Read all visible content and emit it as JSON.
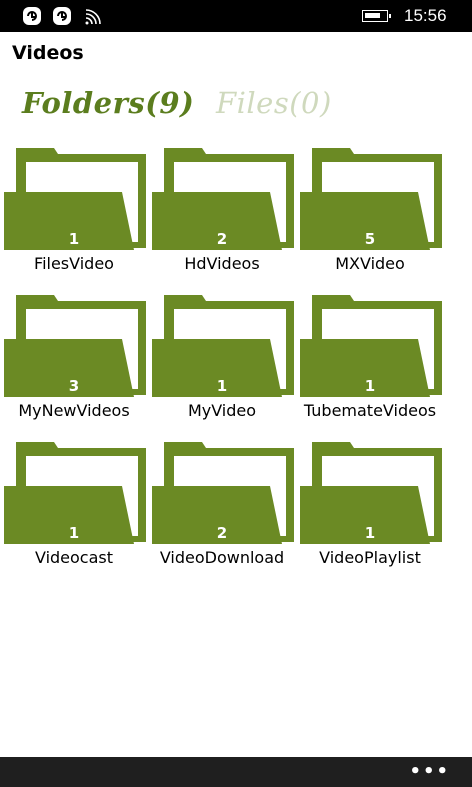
{
  "status_bar": {
    "time": "15:56",
    "icons": [
      "notification-icon",
      "notification-icon",
      "wifi-icon",
      "battery-icon"
    ]
  },
  "page": {
    "title": "Videos"
  },
  "tabs": [
    {
      "label": "Folders(9)",
      "active": true
    },
    {
      "label": "Files(0)",
      "active": false
    }
  ],
  "folders": [
    {
      "name": "FilesVideo",
      "count": "1"
    },
    {
      "name": "HdVideos",
      "count": "2"
    },
    {
      "name": "MXVideo",
      "count": "5"
    },
    {
      "name": "MyNewVideos",
      "count": "3"
    },
    {
      "name": "MyVideo",
      "count": "1"
    },
    {
      "name": "TubemateVideos",
      "count": "1"
    },
    {
      "name": "Videocast",
      "count": "1"
    },
    {
      "name": "VideoDownload",
      "count": "2"
    },
    {
      "name": "VideoPlaylist",
      "count": "1"
    }
  ],
  "app_bar": {
    "more_label": "•••"
  },
  "colors": {
    "folder": "#6b8a24",
    "tab_active": "#5b7d1e",
    "tab_inactive": "#cfd9bd"
  }
}
